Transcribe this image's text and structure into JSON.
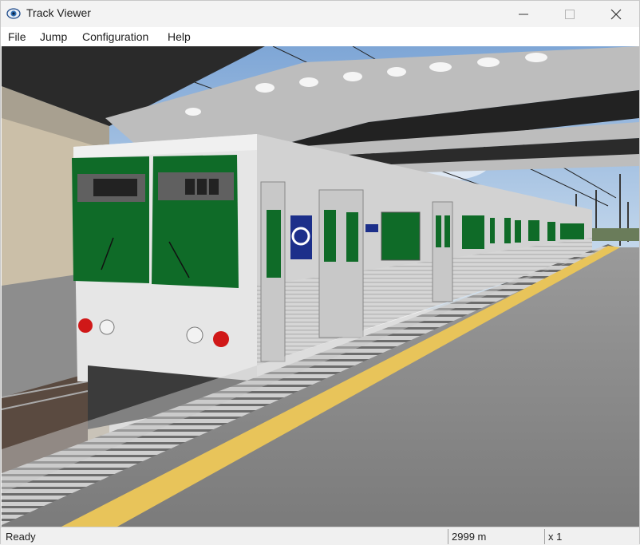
{
  "window": {
    "title": "Track Viewer",
    "icon": "eye-app-icon"
  },
  "controls": {
    "minimize": "minimize-icon",
    "maximize": "maximize-icon",
    "close": "close-icon"
  },
  "menu": {
    "items": [
      "File",
      "Jump",
      "Configuration",
      "Help"
    ]
  },
  "status": {
    "message": "Ready",
    "distance": "2999 m",
    "speed": "x 1"
  },
  "scene": {
    "description_colors": {
      "sky": "#a8c4e0",
      "train_body": "#d4d4d4",
      "train_windows": "#0f5e22",
      "platform_line": "#e8c45a",
      "platform": "#8a8a8a",
      "line_badge": "#1c2f8a"
    }
  }
}
